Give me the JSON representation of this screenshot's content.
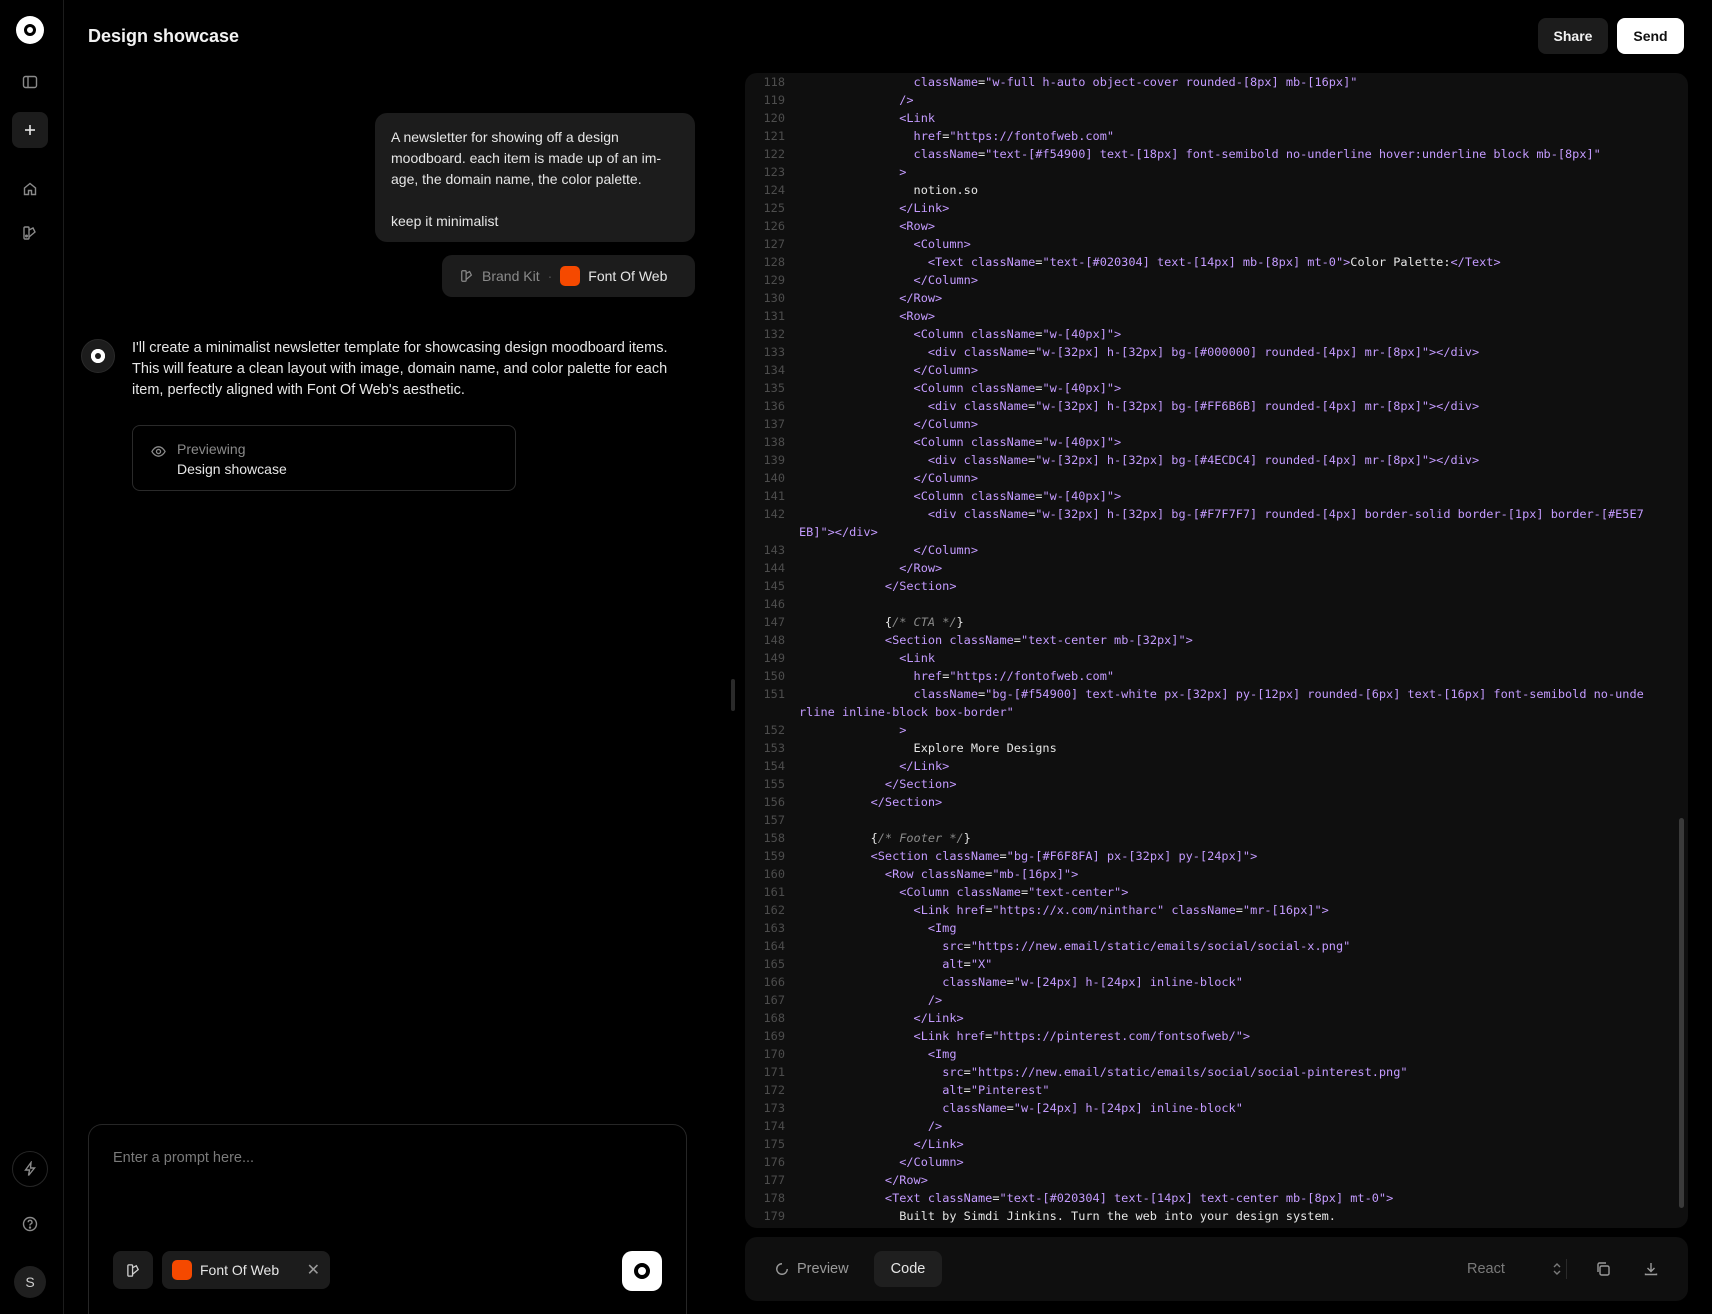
{
  "header": {
    "title": "Design showcase",
    "share_label": "Share",
    "send_label": "Send"
  },
  "rail": {
    "avatar_initial": "S",
    "icons": [
      "logo-icon",
      "sidebar-toggle-icon",
      "plus-icon",
      "home-icon",
      "brand-kit-icon",
      "bolt-icon",
      "help-icon"
    ]
  },
  "chat": {
    "user_message": "A newsletter for showing off a design moodboard. each item is made up of an im-age, the domain name, the color palette.\n\nkeep it minimalist",
    "context": {
      "brand_kit_label": "Brand Kit",
      "separator": "·",
      "brand_name": "Font Of Web",
      "brand_color": "#f54900"
    },
    "ai_message": "I'll create a minimalist newsletter template for showcasing design moodboard items. This will feature a clean layout with image, domain name, and color palette for each item, perfectly aligned with Font Of Web's aesthetic.",
    "preview_card": {
      "label": "Previewing",
      "name": "Design showcase"
    }
  },
  "prompt": {
    "placeholder": "Enter a prompt here...",
    "brand_tag": "Font Of Web",
    "remove_label": "✕"
  },
  "code": {
    "lines": [
      {
        "n": "118",
        "html": "                <span class=\"tok-attr\">className</span>=<span class=\"tok-str\">\"w-full h-auto object-cover rounded-[8px] mb-[16px]\"</span>"
      },
      {
        "n": "119",
        "html": "              <span class=\"tok-tag\">/&gt;</span>"
      },
      {
        "n": "120",
        "html": "              <span class=\"tok-tag\">&lt;Link</span>"
      },
      {
        "n": "121",
        "html": "                <span class=\"tok-attr\">href</span>=<span class=\"tok-str\">\"https://fontofweb.com\"</span>"
      },
      {
        "n": "122",
        "html": "                <span class=\"tok-attr\">className</span>=<span class=\"tok-str\">\"text-[#f54900] text-[18px] font-semibold no-underline hover:underline block mb-[8px]\"</span>"
      },
      {
        "n": "123",
        "html": "              <span class=\"tok-tag\">&gt;</span>"
      },
      {
        "n": "124",
        "html": "                notion.so"
      },
      {
        "n": "125",
        "html": "              <span class=\"tok-tag\">&lt;/Link&gt;</span>"
      },
      {
        "n": "126",
        "html": "              <span class=\"tok-tag\">&lt;Row&gt;</span>"
      },
      {
        "n": "127",
        "html": "                <span class=\"tok-tag\">&lt;Column&gt;</span>"
      },
      {
        "n": "128",
        "html": "                  <span class=\"tok-tag\">&lt;Text</span> <span class=\"tok-attr\">className</span>=<span class=\"tok-str\">\"text-[#020304] text-[14px] mb-[8px] mt-0\"</span><span class=\"tok-tag\">&gt;</span>Color Palette:<span class=\"tok-tag\">&lt;/Text&gt;</span>"
      },
      {
        "n": "129",
        "html": "                <span class=\"tok-tag\">&lt;/Column&gt;</span>"
      },
      {
        "n": "130",
        "html": "              <span class=\"tok-tag\">&lt;/Row&gt;</span>"
      },
      {
        "n": "131",
        "html": "              <span class=\"tok-tag\">&lt;Row&gt;</span>"
      },
      {
        "n": "132",
        "html": "                <span class=\"tok-tag\">&lt;Column</span> <span class=\"tok-attr\">className</span>=<span class=\"tok-str\">\"w-[40px]\"</span><span class=\"tok-tag\">&gt;</span>"
      },
      {
        "n": "133",
        "html": "                  <span class=\"tok-tag\">&lt;div</span> <span class=\"tok-attr\">className</span>=<span class=\"tok-str\">\"w-[32px] h-[32px] bg-[#000000] rounded-[4px] mr-[8px]\"</span><span class=\"tok-tag\">&gt;&lt;/div&gt;</span>"
      },
      {
        "n": "134",
        "html": "                <span class=\"tok-tag\">&lt;/Column&gt;</span>"
      },
      {
        "n": "135",
        "html": "                <span class=\"tok-tag\">&lt;Column</span> <span class=\"tok-attr\">className</span>=<span class=\"tok-str\">\"w-[40px]\"</span><span class=\"tok-tag\">&gt;</span>"
      },
      {
        "n": "136",
        "html": "                  <span class=\"tok-tag\">&lt;div</span> <span class=\"tok-attr\">className</span>=<span class=\"tok-str\">\"w-[32px] h-[32px] bg-[#FF6B6B] rounded-[4px] mr-[8px]\"</span><span class=\"tok-tag\">&gt;&lt;/div&gt;</span>"
      },
      {
        "n": "137",
        "html": "                <span class=\"tok-tag\">&lt;/Column&gt;</span>"
      },
      {
        "n": "138",
        "html": "                <span class=\"tok-tag\">&lt;Column</span> <span class=\"tok-attr\">className</span>=<span class=\"tok-str\">\"w-[40px]\"</span><span class=\"tok-tag\">&gt;</span>"
      },
      {
        "n": "139",
        "html": "                  <span class=\"tok-tag\">&lt;div</span> <span class=\"tok-attr\">className</span>=<span class=\"tok-str\">\"w-[32px] h-[32px] bg-[#4ECDC4] rounded-[4px] mr-[8px]\"</span><span class=\"tok-tag\">&gt;&lt;/div&gt;</span>"
      },
      {
        "n": "140",
        "html": "                <span class=\"tok-tag\">&lt;/Column&gt;</span>"
      },
      {
        "n": "141",
        "html": "                <span class=\"tok-tag\">&lt;Column</span> <span class=\"tok-attr\">className</span>=<span class=\"tok-str\">\"w-[40px]\"</span><span class=\"tok-tag\">&gt;</span>"
      },
      {
        "n": "142",
        "wrap": true,
        "html": "                  <span class=\"tok-tag\">&lt;div</span> <span class=\"tok-attr\">className</span>=<span class=\"tok-str\">\"w-[32px] h-[32px] bg-[#F7F7F7] rounded-[4px] border-solid border-[1px] border-[#E5E7EB]\"</span><span class=\"tok-tag\">&gt;&lt;/div&gt;</span>"
      },
      {
        "n": "143",
        "html": "                <span class=\"tok-tag\">&lt;/Column&gt;</span>"
      },
      {
        "n": "144",
        "html": "              <span class=\"tok-tag\">&lt;/Row&gt;</span>"
      },
      {
        "n": "145",
        "html": "            <span class=\"tok-tag\">&lt;/Section&gt;</span>"
      },
      {
        "n": "146",
        "html": ""
      },
      {
        "n": "147",
        "html": "            {<span class=\"tok-cmt\">/* CTA */</span>}"
      },
      {
        "n": "148",
        "html": "            <span class=\"tok-tag\">&lt;Section</span> <span class=\"tok-attr\">className</span>=<span class=\"tok-str\">\"text-center mb-[32px]\"</span><span class=\"tok-tag\">&gt;</span>"
      },
      {
        "n": "149",
        "html": "              <span class=\"tok-tag\">&lt;Link</span>"
      },
      {
        "n": "150",
        "html": "                <span class=\"tok-attr\">href</span>=<span class=\"tok-str\">\"https://fontofweb.com\"</span>"
      },
      {
        "n": "151",
        "wrap": true,
        "html": "                <span class=\"tok-attr\">className</span>=<span class=\"tok-str\">\"bg-[#f54900] text-white px-[32px] py-[12px] rounded-[6px] text-[16px] font-semibold no-underline inline-block box-border\"</span>"
      },
      {
        "n": "152",
        "html": "              <span class=\"tok-tag\">&gt;</span>"
      },
      {
        "n": "153",
        "html": "                Explore More Designs"
      },
      {
        "n": "154",
        "html": "              <span class=\"tok-tag\">&lt;/Link&gt;</span>"
      },
      {
        "n": "155",
        "html": "            <span class=\"tok-tag\">&lt;/Section&gt;</span>"
      },
      {
        "n": "156",
        "html": "          <span class=\"tok-tag\">&lt;/Section&gt;</span>"
      },
      {
        "n": "157",
        "html": ""
      },
      {
        "n": "158",
        "html": "          {<span class=\"tok-cmt\">/* Footer */</span>}"
      },
      {
        "n": "159",
        "html": "          <span class=\"tok-tag\">&lt;Section</span> <span class=\"tok-attr\">className</span>=<span class=\"tok-str\">\"bg-[#F6F8FA] px-[32px] py-[24px]\"</span><span class=\"tok-tag\">&gt;</span>"
      },
      {
        "n": "160",
        "html": "            <span class=\"tok-tag\">&lt;Row</span> <span class=\"tok-attr\">className</span>=<span class=\"tok-str\">\"mb-[16px]\"</span><span class=\"tok-tag\">&gt;</span>"
      },
      {
        "n": "161",
        "html": "              <span class=\"tok-tag\">&lt;Column</span> <span class=\"tok-attr\">className</span>=<span class=\"tok-str\">\"text-center\"</span><span class=\"tok-tag\">&gt;</span>"
      },
      {
        "n": "162",
        "html": "                <span class=\"tok-tag\">&lt;Link</span> <span class=\"tok-attr\">href</span>=<span class=\"tok-str\">\"https://x.com/nintharc\"</span> <span class=\"tok-attr\">className</span>=<span class=\"tok-str\">\"mr-[16px]\"</span><span class=\"tok-tag\">&gt;</span>"
      },
      {
        "n": "163",
        "html": "                  <span class=\"tok-tag\">&lt;Img</span>"
      },
      {
        "n": "164",
        "html": "                    <span class=\"tok-attr\">src</span>=<span class=\"tok-str\">\"https://new.email/static/emails/social/social-x.png\"</span>"
      },
      {
        "n": "165",
        "html": "                    <span class=\"tok-attr\">alt</span>=<span class=\"tok-str\">\"X\"</span>"
      },
      {
        "n": "166",
        "html": "                    <span class=\"tok-attr\">className</span>=<span class=\"tok-str\">\"w-[24px] h-[24px] inline-block\"</span>"
      },
      {
        "n": "167",
        "html": "                  <span class=\"tok-tag\">/&gt;</span>"
      },
      {
        "n": "168",
        "html": "                <span class=\"tok-tag\">&lt;/Link&gt;</span>"
      },
      {
        "n": "169",
        "html": "                <span class=\"tok-tag\">&lt;Link</span> <span class=\"tok-attr\">href</span>=<span class=\"tok-str\">\"https://pinterest.com/fontsofweb/\"</span><span class=\"tok-tag\">&gt;</span>"
      },
      {
        "n": "170",
        "html": "                  <span class=\"tok-tag\">&lt;Img</span>"
      },
      {
        "n": "171",
        "html": "                    <span class=\"tok-attr\">src</span>=<span class=\"tok-str\">\"https://new.email/static/emails/social/social-pinterest.png\"</span>"
      },
      {
        "n": "172",
        "html": "                    <span class=\"tok-attr\">alt</span>=<span class=\"tok-str\">\"Pinterest\"</span>"
      },
      {
        "n": "173",
        "html": "                    <span class=\"tok-attr\">className</span>=<span class=\"tok-str\">\"w-[24px] h-[24px] inline-block\"</span>"
      },
      {
        "n": "174",
        "html": "                  <span class=\"tok-tag\">/&gt;</span>"
      },
      {
        "n": "175",
        "html": "                <span class=\"tok-tag\">&lt;/Link&gt;</span>"
      },
      {
        "n": "176",
        "html": "              <span class=\"tok-tag\">&lt;/Column&gt;</span>"
      },
      {
        "n": "177",
        "html": "            <span class=\"tok-tag\">&lt;/Row&gt;</span>"
      },
      {
        "n": "178",
        "html": "            <span class=\"tok-tag\">&lt;Text</span> <span class=\"tok-attr\">className</span>=<span class=\"tok-str\">\"text-[#020304] text-[14px] text-center mb-[8px] mt-0\"</span><span class=\"tok-tag\">&gt;</span>"
      },
      {
        "n": "179",
        "html": "              Built by Simdi Jinkins. Turn the web into your design system."
      }
    ]
  },
  "toolbar": {
    "preview_label": "Preview",
    "code_label": "Code",
    "language": "React"
  }
}
